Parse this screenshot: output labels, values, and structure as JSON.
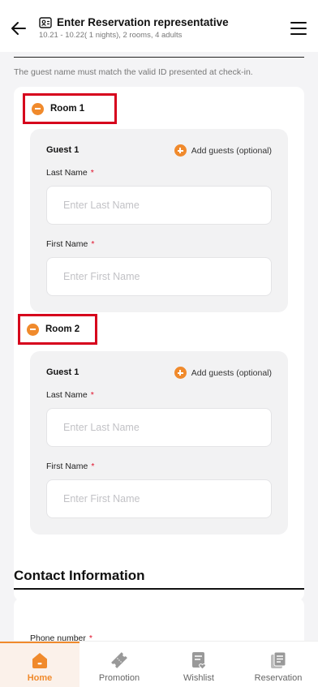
{
  "header": {
    "title": "Enter Reservation representative",
    "subtitle": "10.21 - 10.22( 1 nights), 2 rooms, 4 adults"
  },
  "notice": "The guest name must match the valid ID presented at check-in.",
  "rooms": [
    {
      "label": "Room 1",
      "guest_title": "Guest 1",
      "add_guests_label": "Add guests (optional)",
      "last_name_label": "Last Name",
      "last_name_placeholder": "Enter Last Name",
      "last_name_value": "",
      "first_name_label": "First Name",
      "first_name_placeholder": "Enter First Name",
      "first_name_value": ""
    },
    {
      "label": "Room 2",
      "guest_title": "Guest 1",
      "add_guests_label": "Add guests (optional)",
      "last_name_label": "Last Name",
      "last_name_placeholder": "Enter Last Name",
      "last_name_value": "",
      "first_name_label": "First Name",
      "first_name_placeholder": "Enter First Name",
      "first_name_value": ""
    }
  ],
  "required_mark": "*",
  "contact": {
    "title": "Contact Information",
    "phone_label": "Phone number"
  },
  "nav": {
    "items": [
      {
        "label": "Home",
        "icon": "home-icon",
        "active": true
      },
      {
        "label": "Promotion",
        "icon": "promotion-ticket-icon",
        "active": false
      },
      {
        "label": "Wishlist",
        "icon": "wishlist-icon",
        "active": false
      },
      {
        "label": "Reservation",
        "icon": "reservation-icon",
        "active": false
      }
    ]
  },
  "colors": {
    "accent": "#f08a2c",
    "required": "#e0102a",
    "highlight_box": "#d6001c",
    "background": "#f4f4f6"
  }
}
